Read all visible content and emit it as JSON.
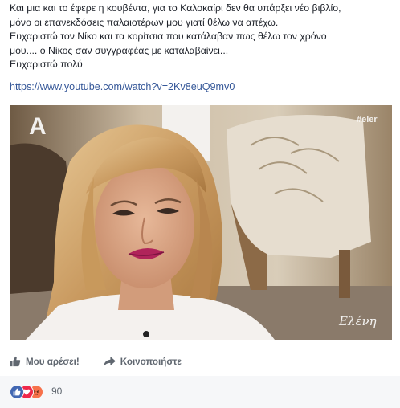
{
  "post": {
    "lines": [
      "Και μια και το έφερε η κουβέντα, για το Καλοκαίρι δεν θα υπάρξει νέο βιβλίο,",
      "μόνο οι επανεκδόσεις παλαιοτέρων μου γιατί θέλω να απέχω.",
      "Ευχαριστώ τον Νίκο και τα κορίτσια που κατάλαβαν πως θέλω τον χρόνο",
      "μου.... ο Νίκος σαν συγγραφέας με καταλαβαίνει...",
      "Ευχαριστώ πολύ"
    ],
    "link": "https://www.youtube.com/watch?v=2Kv8euQ9mv0"
  },
  "video": {
    "channel_logo": "A",
    "hashtag": "#eler",
    "watermark": "Ελένη"
  },
  "actions": {
    "like_label": "Μου αρέσει!",
    "share_label": "Κοινοποιήστε"
  },
  "reactions": {
    "icons": [
      "like-icon",
      "love-icon",
      "angry-icon"
    ],
    "count": "90"
  },
  "colors": {
    "link": "#365899",
    "like_blue": "#4267b2",
    "love_red": "#f0284a",
    "angry_orange": "#f7714b"
  }
}
